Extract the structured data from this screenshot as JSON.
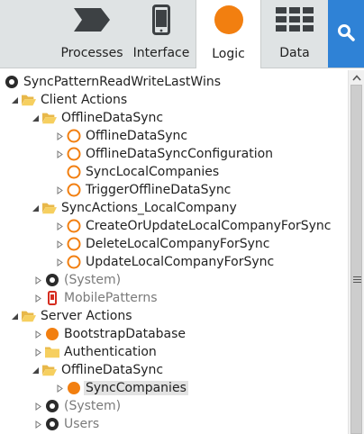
{
  "toolbar": {
    "tabs": [
      {
        "label": "Processes",
        "icon": "processes-icon"
      },
      {
        "label": "Interface",
        "icon": "mobile-device-icon"
      },
      {
        "label": "Logic",
        "icon": "logic-circle-icon",
        "active": true
      },
      {
        "label": "Data",
        "icon": "table-grid-icon"
      }
    ],
    "search_icon": "search-icon",
    "colors": {
      "accent_blue": "#2f82d6",
      "logic_orange": "#f27f10",
      "bar_bg": "#dfe3e4"
    }
  },
  "tree": {
    "root": "SyncPatternReadWriteLastWins",
    "client_actions": "Client Actions",
    "offline_folder": "OfflineDataSync",
    "offline_items": [
      "OfflineDataSync",
      "OfflineDataSyncConfiguration",
      "SyncLocalCompanies",
      "TriggerOfflineDataSync"
    ],
    "sync_folder": "SyncActions_LocalCompany",
    "sync_items": [
      "CreateOrUpdateLocalCompanyForSync",
      "DeleteLocalCompanyForSync",
      "UpdateLocalCompanyForSync"
    ],
    "client_system": "(System)",
    "mobile_patterns": "MobilePatterns",
    "server_actions": "Server Actions",
    "bootstrap": "BootstrapDatabase",
    "authentication": "Authentication",
    "server_offline_folder": "OfflineDataSync",
    "sync_companies": "SyncCompanies",
    "server_system": "(System)",
    "users": "Users"
  }
}
